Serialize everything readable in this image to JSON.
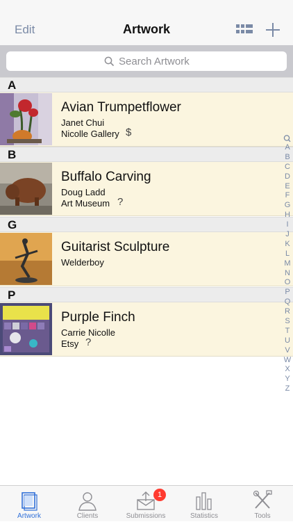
{
  "nav": {
    "edit_label": "Edit",
    "title": "Artwork"
  },
  "search": {
    "placeholder": "Search Artwork"
  },
  "sections": [
    {
      "letter": "A",
      "items": [
        {
          "title": "Avian Trumpetflower",
          "artist": "Janet Chui",
          "location": "Nicolle Gallery",
          "status": "$"
        }
      ]
    },
    {
      "letter": "B",
      "items": [
        {
          "title": "Buffalo Carving",
          "artist": "Doug Ladd",
          "location": "Art Museum",
          "status": "?"
        }
      ]
    },
    {
      "letter": "G",
      "items": [
        {
          "title": "Guitarist Sculpture",
          "artist": "Welderboy",
          "location": "",
          "status": ""
        }
      ]
    },
    {
      "letter": "P",
      "items": [
        {
          "title": "Purple Finch",
          "artist": "Carrie Nicolle",
          "location": "Etsy",
          "status": "?"
        }
      ]
    }
  ],
  "index": [
    "A",
    "B",
    "C",
    "D",
    "E",
    "F",
    "G",
    "H",
    "I",
    "J",
    "K",
    "L",
    "M",
    "N",
    "O",
    "P",
    "Q",
    "R",
    "S",
    "T",
    "U",
    "V",
    "W",
    "X",
    "Y",
    "Z"
  ],
  "tabs": [
    {
      "label": "Artwork",
      "icon": "artwork-icon",
      "active": true
    },
    {
      "label": "Clients",
      "icon": "person-icon",
      "active": false
    },
    {
      "label": "Submissions",
      "icon": "submissions-icon",
      "active": false,
      "badge": "1"
    },
    {
      "label": "Statistics",
      "icon": "statistics-icon",
      "active": false
    },
    {
      "label": "Tools",
      "icon": "tools-icon",
      "active": false
    }
  ],
  "colors": {
    "accent": "#7a8aa6",
    "active_tab": "#2f6fd8",
    "row_bg": "#fbf5df",
    "badge": "#ff3b30"
  }
}
